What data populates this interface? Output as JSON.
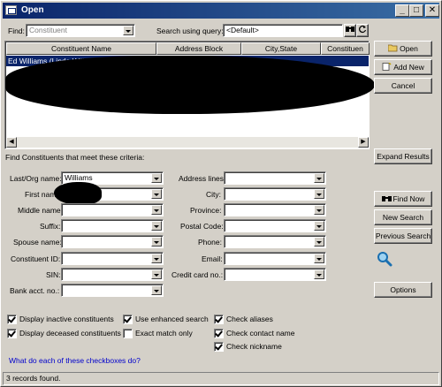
{
  "window": {
    "title": "Open",
    "minimize": "_",
    "maximize": "□",
    "close": "✕"
  },
  "toolbar": {
    "find_label": "Find:",
    "find_value": "Constituent",
    "query_label": "Search using query:",
    "query_value": "<Default>"
  },
  "grid": {
    "columns": [
      "Constituent Name",
      "Address Block",
      "City,State",
      "Constituen"
    ],
    "selected_row": "Ed Williams (Linda Williams)"
  },
  "side_buttons": {
    "open": "Open",
    "add_new": "Add New",
    "cancel": "Cancel",
    "expand_results": "Expand Results",
    "find_now": "Find Now",
    "new_search": "New Search",
    "previous_search": "Previous Search",
    "options": "Options"
  },
  "criteria": {
    "heading": "Find Constituents that meet these criteria:",
    "left": [
      {
        "label": "Last/Org name:",
        "value": "Williams"
      },
      {
        "label": "First name:",
        "value": ""
      },
      {
        "label": "Middle name:",
        "value": ""
      },
      {
        "label": "Suffix:",
        "value": ""
      },
      {
        "label": "Spouse name:",
        "value": ""
      },
      {
        "label": "Constituent ID:",
        "value": ""
      },
      {
        "label": "SIN:",
        "value": ""
      },
      {
        "label": "Bank acct. no.:",
        "value": ""
      }
    ],
    "right": [
      {
        "label": "Address lines:",
        "value": ""
      },
      {
        "label": "City:",
        "value": ""
      },
      {
        "label": "Province:",
        "value": ""
      },
      {
        "label": "Postal Code:",
        "value": ""
      },
      {
        "label": "Phone:",
        "value": ""
      },
      {
        "label": "Email:",
        "value": ""
      },
      {
        "label": "Credit card no.:",
        "value": ""
      }
    ]
  },
  "checkboxes": [
    {
      "label": "Display inactive constituents",
      "checked": true
    },
    {
      "label": "Display deceased constituents",
      "checked": true
    },
    {
      "label": "Use enhanced search",
      "checked": true
    },
    {
      "label": "Exact match only",
      "checked": false
    },
    {
      "label": "Check aliases",
      "checked": true
    },
    {
      "label": "Check contact name",
      "checked": true
    },
    {
      "label": "Check nickname",
      "checked": true
    }
  ],
  "help_link": "What do each of these checkboxes do?",
  "status": "3 records found.",
  "colors": {
    "titlebar": "#0a246a",
    "selection": "#0a246a",
    "link": "#0000cc",
    "face": "#d4d0c8"
  }
}
